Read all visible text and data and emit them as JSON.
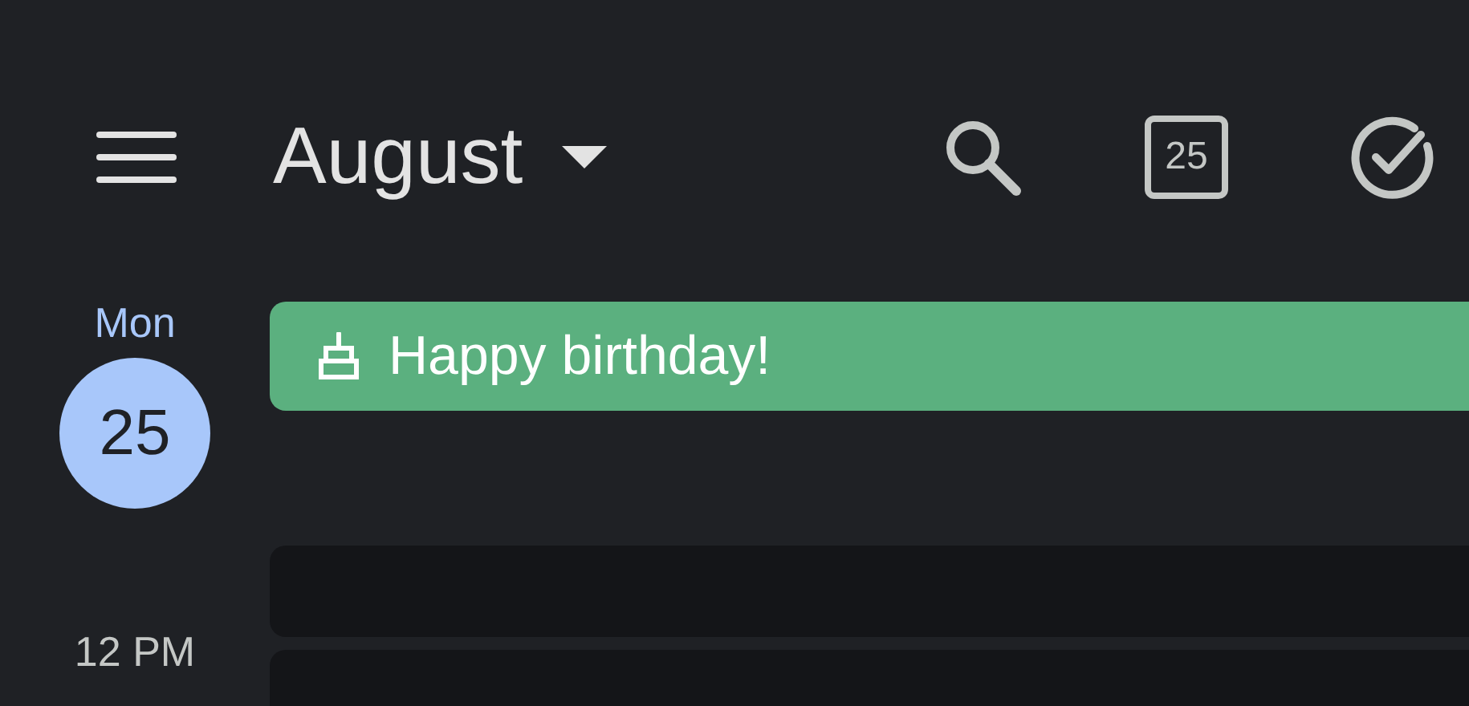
{
  "header": {
    "title": "August",
    "calendar_icon_date": "25"
  },
  "day": {
    "weekday": "Mon",
    "date": "25",
    "selected": true
  },
  "all_day_events": [
    {
      "title": "Happy birthday!",
      "color": "#5bb07f"
    }
  ],
  "time_labels": [
    "12 PM"
  ]
}
